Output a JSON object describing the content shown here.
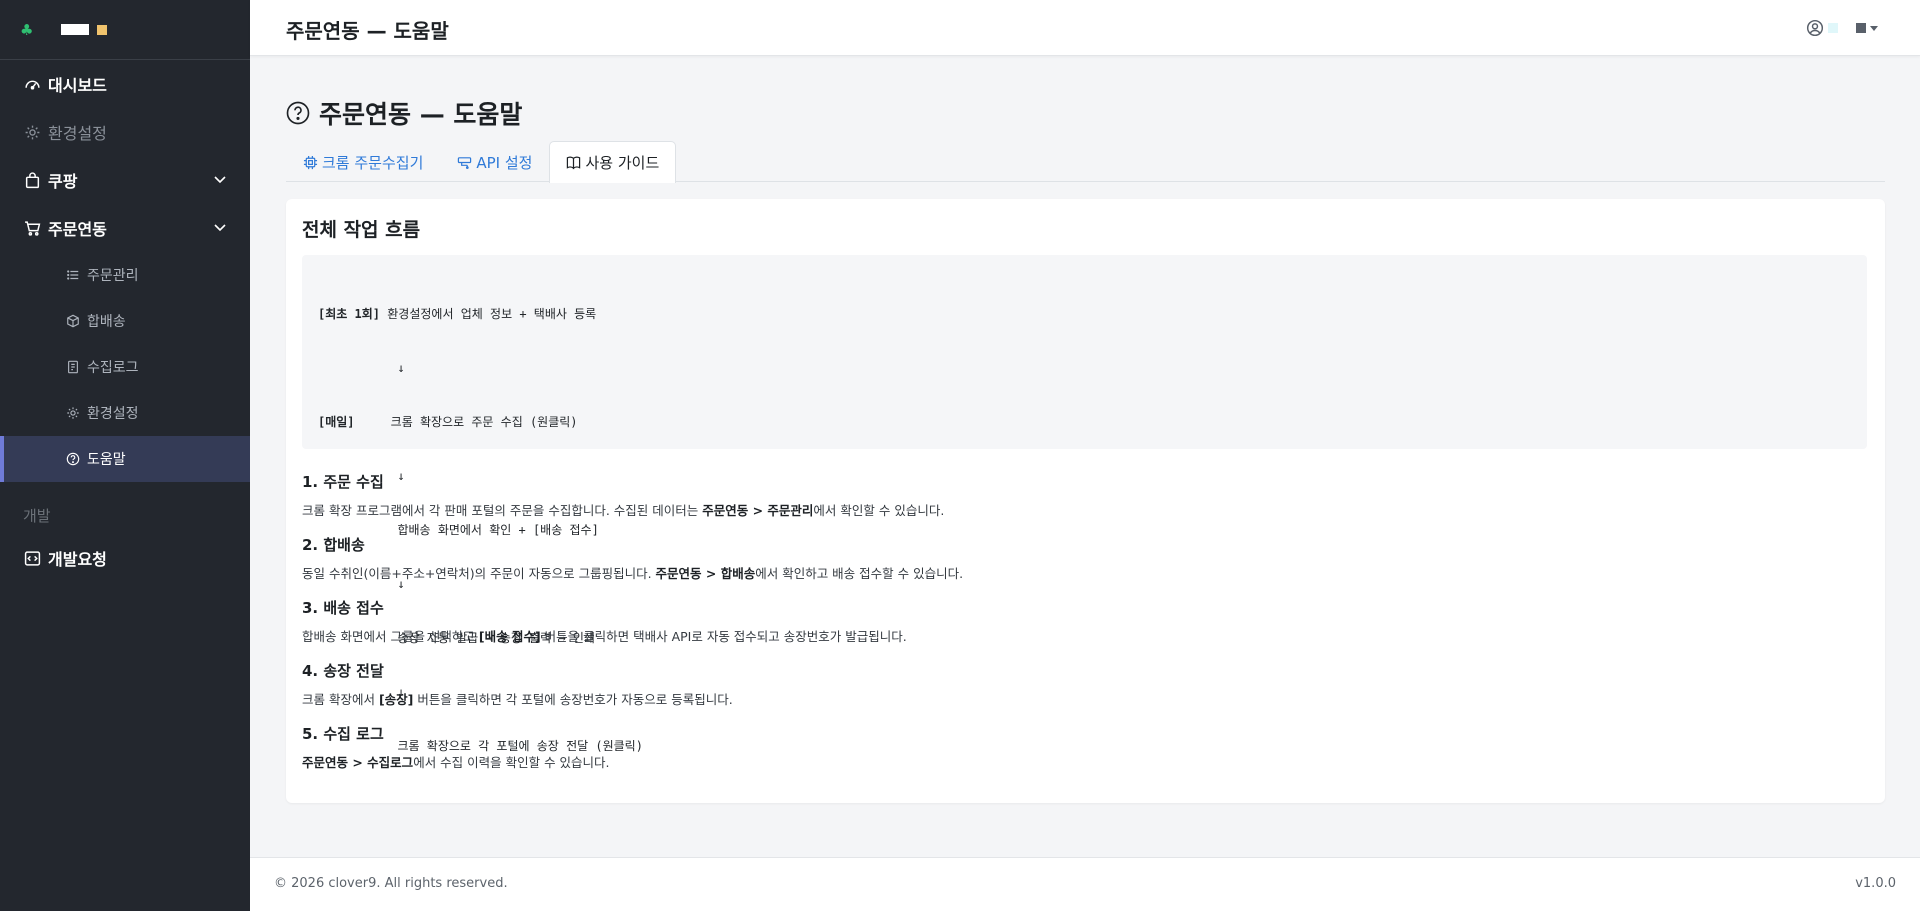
{
  "brand": {
    "icon": "clover-icon"
  },
  "sidebar": {
    "items": [
      {
        "label": "대시보드",
        "icon": "speedometer-icon"
      },
      {
        "label": "환경설정",
        "icon": "gear-icon"
      },
      {
        "label": "쿠팡",
        "icon": "bag-icon"
      },
      {
        "label": "주문연동",
        "icon": "cart-icon"
      }
    ],
    "sub_items": [
      {
        "label": "주문관리",
        "icon": "list-icon"
      },
      {
        "label": "합배송",
        "icon": "box-icon"
      },
      {
        "label": "수집로그",
        "icon": "journal-icon"
      },
      {
        "label": "환경설정",
        "icon": "gear-icon"
      },
      {
        "label": "도움말",
        "icon": "question-circle-icon"
      }
    ],
    "section_label": "개발",
    "dev_item": {
      "label": "개발요청",
      "icon": "code-icon"
    }
  },
  "header": {
    "title": "주문연동 — 도움말"
  },
  "page": {
    "title": "주문연동 — 도움말",
    "tabs": [
      {
        "label": "크롬 주문수집기",
        "icon": "cpu-icon"
      },
      {
        "label": "API 설정",
        "icon": "api-icon"
      },
      {
        "label": "사용 가이드",
        "icon": "book-icon"
      }
    ],
    "card": {
      "heading": "전체 작업 흐름",
      "flow": [
        {
          "tag": "[최초 1회]",
          "text": " 환경설정에서 업체 정보 + 택배사 등록"
        },
        {
          "tag": "",
          "text": "           ↓"
        },
        {
          "tag": "[매일]",
          "text": "     크롬 확장으로 주문 수집 (원클릭)"
        },
        {
          "tag": "",
          "text": "           ↓"
        },
        {
          "tag": "",
          "text": "           합배송 화면에서 확인 + [배송 접수]"
        },
        {
          "tag": "",
          "text": "           ↓"
        },
        {
          "tag": "",
          "text": "           송장 자동 발급 → 송장 출력 → 인쇄"
        },
        {
          "tag": "",
          "text": "           ↓"
        },
        {
          "tag": "",
          "text": "           크롬 확장으로 각 포털에 송장 전달 (원클릭)"
        }
      ],
      "sections": [
        {
          "title": "1. 주문 수집",
          "parts": [
            {
              "t": "크롬 확장 프로그램에서 각 판매 포털의 주문을 수집합니다. 수집된 데이터는 ",
              "b": false
            },
            {
              "t": "주문연동 > 주문관리",
              "b": true
            },
            {
              "t": "에서 확인할 수 있습니다.",
              "b": false
            }
          ]
        },
        {
          "title": "2. 합배송",
          "parts": [
            {
              "t": "동일 수취인(이름+주소+연락처)의 주문이 자동으로 그룹핑됩니다. ",
              "b": false
            },
            {
              "t": "주문연동 > 합배송",
              "b": true
            },
            {
              "t": "에서 확인하고 배송 접수할 수 있습니다.",
              "b": false
            }
          ]
        },
        {
          "title": "3. 배송 접수",
          "parts": [
            {
              "t": "합배송 화면에서 그룹을 선택하고 ",
              "b": false
            },
            {
              "t": "[배송 접수]",
              "b": true
            },
            {
              "t": " 버튼을 클릭하면 택배사 API로 자동 접수되고 송장번호가 발급됩니다.",
              "b": false
            }
          ]
        },
        {
          "title": "4. 송장 전달",
          "parts": [
            {
              "t": "크롬 확장에서 ",
              "b": false
            },
            {
              "t": "[송장]",
              "b": true
            },
            {
              "t": " 버튼을 클릭하면 각 포털에 송장번호가 자동으로 등록됩니다.",
              "b": false
            }
          ]
        },
        {
          "title": "5. 수집 로그",
          "parts": [
            {
              "t": "주문연동 > 수집로그",
              "b": true
            },
            {
              "t": "에서 수집 이력을 확인할 수 있습니다.",
              "b": false
            }
          ]
        }
      ]
    }
  },
  "footer": {
    "copyright": "© 2026 clover9. All rights reserved.",
    "version": "v1.0.0"
  },
  "colors": {
    "sidebar_bg": "#23272e",
    "active_bg": "#343b56",
    "accent": "#6f7bd8",
    "link": "#2f7ad8"
  }
}
